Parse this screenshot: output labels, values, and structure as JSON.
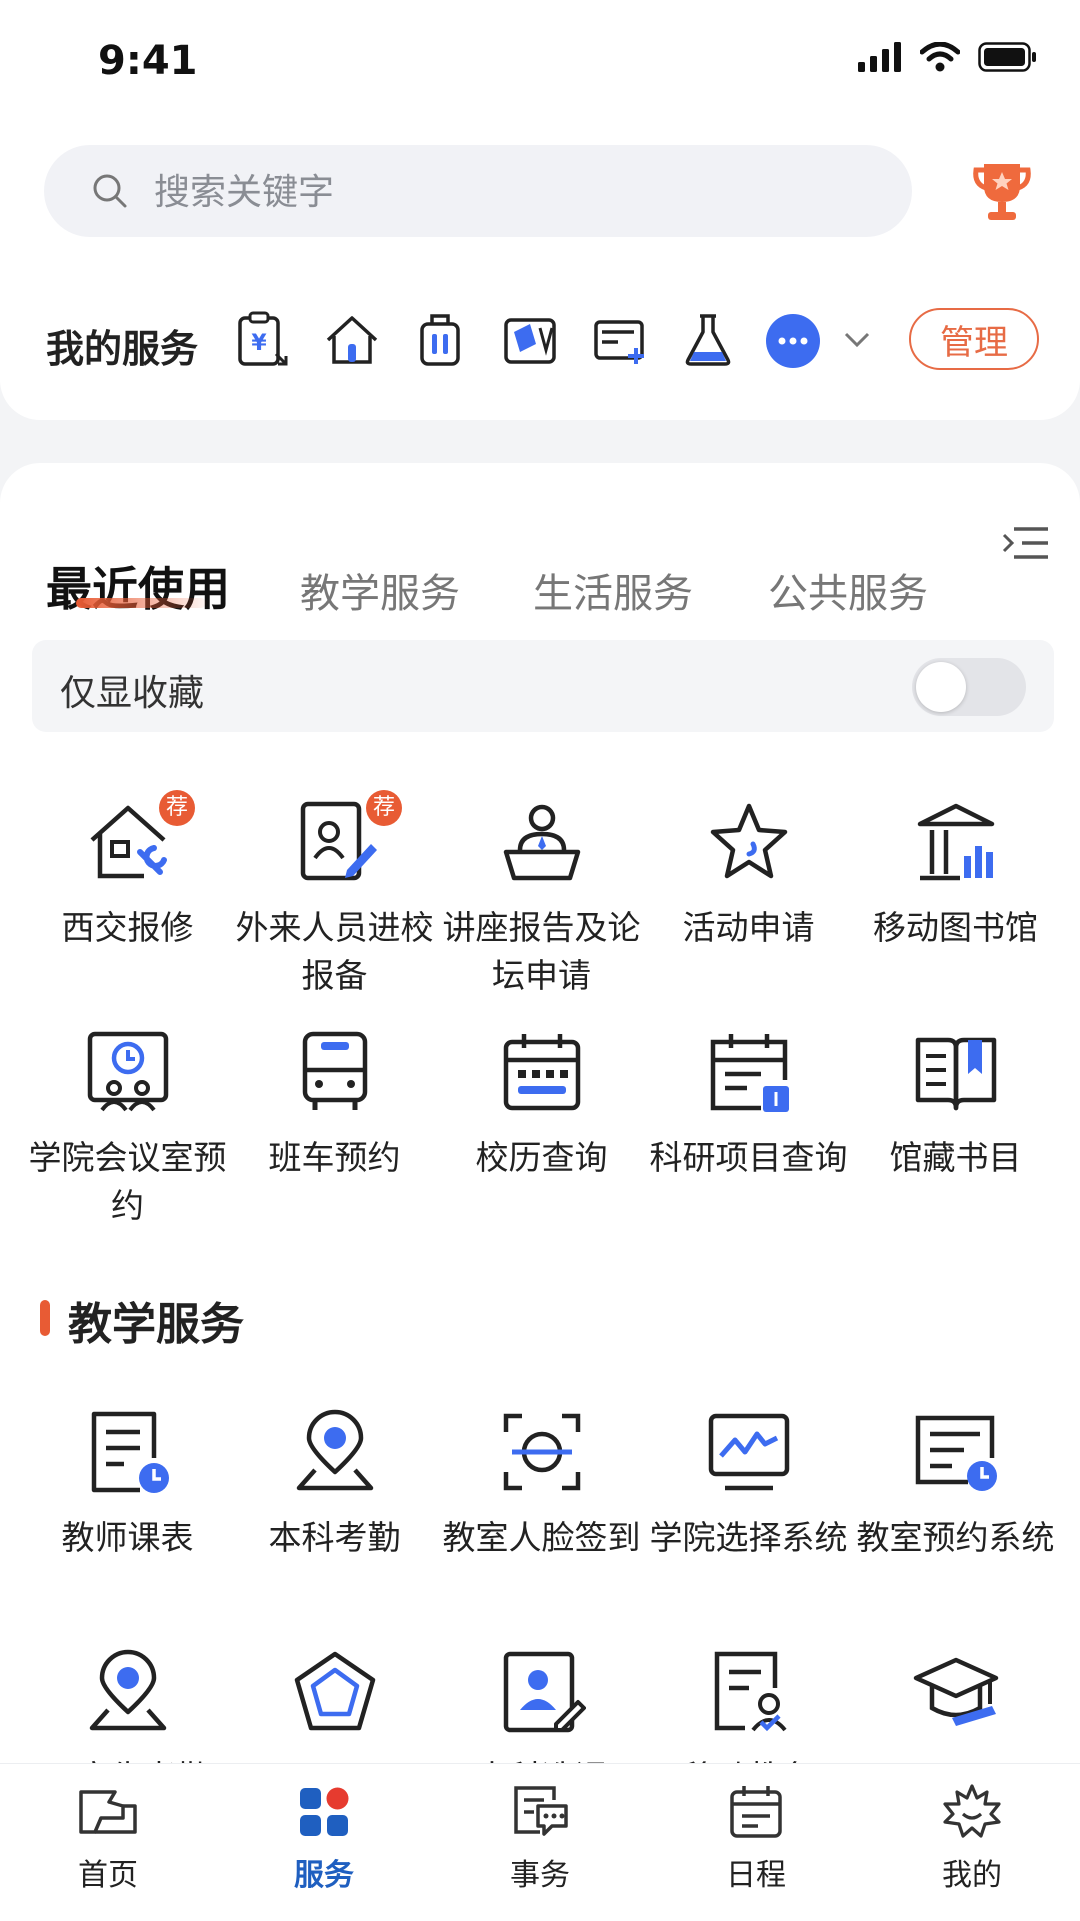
{
  "status_bar": {
    "time": "9:41"
  },
  "search": {
    "placeholder": "搜索关键字",
    "value": ""
  },
  "my_services": {
    "title": "我的服务",
    "quick_icons": [
      "payment-clipboard-icon",
      "home-icon",
      "luggage-icon",
      "id-card-icon",
      "card-add-icon",
      "flask-icon"
    ],
    "manage_label": "管理"
  },
  "tabs": [
    {
      "label": "最近使用",
      "active": true
    },
    {
      "label": "教学服务",
      "active": false
    },
    {
      "label": "生活服务",
      "active": false
    },
    {
      "label": "公共服务",
      "active": false
    }
  ],
  "favorites_toggle": {
    "label": "仅显收藏",
    "enabled": false
  },
  "recent_items": [
    {
      "label": "西交报修",
      "icon": "house-repair-icon",
      "badge": "荐"
    },
    {
      "label": "外来人员进校报备",
      "icon": "visitor-registration-icon",
      "badge": "荐"
    },
    {
      "label": "讲座报告及论坛申请",
      "icon": "lecture-podium-icon",
      "badge": ""
    },
    {
      "label": "活动申请",
      "icon": "star-icon",
      "badge": ""
    },
    {
      "label": "移动图书馆",
      "icon": "library-icon",
      "badge": ""
    },
    {
      "label": "学院会议室预约",
      "icon": "meeting-room-icon",
      "badge": ""
    },
    {
      "label": "班车预约",
      "icon": "bus-icon",
      "badge": ""
    },
    {
      "label": "校历查询",
      "icon": "calendar-icon",
      "badge": ""
    },
    {
      "label": "科研项目查询",
      "icon": "research-calendar-icon",
      "badge": ""
    },
    {
      "label": "馆藏书目",
      "icon": "book-icon",
      "badge": ""
    }
  ],
  "teaching_section": {
    "title": "教学服务",
    "items": [
      {
        "label": "教师课表",
        "icon": "schedule-clock-icon"
      },
      {
        "label": "本科考勤",
        "icon": "location-pin-icon"
      },
      {
        "label": "教室人脸签到",
        "icon": "face-scan-icon"
      },
      {
        "label": "学院选择系统",
        "icon": "monitor-chart-icon"
      },
      {
        "label": "教室预约系统",
        "icon": "room-booking-icon"
      },
      {
        "label": "研究生考勤",
        "icon": "location-pin-icon"
      },
      {
        "label": "",
        "icon": "pentagon-icon"
      },
      {
        "label": "本科选课",
        "icon": "course-selection-icon"
      },
      {
        "label": "移动教务",
        "icon": "mobile-affairs-icon"
      },
      {
        "label": "",
        "icon": "graduation-cap-icon"
      }
    ]
  },
  "bottom_nav": [
    {
      "label": "首页",
      "icon": "home-nav-icon",
      "active": false
    },
    {
      "label": "服务",
      "icon": "services-grid-icon",
      "active": true
    },
    {
      "label": "事务",
      "icon": "affairs-chat-icon",
      "active": false
    },
    {
      "label": "日程",
      "icon": "schedule-nav-icon",
      "active": false
    },
    {
      "label": "我的",
      "icon": "profile-leaf-icon",
      "active": false
    }
  ],
  "colors": {
    "accent": "#e85b34",
    "blue": "#3d6cf0",
    "nav_active": "#1f5fc0"
  }
}
